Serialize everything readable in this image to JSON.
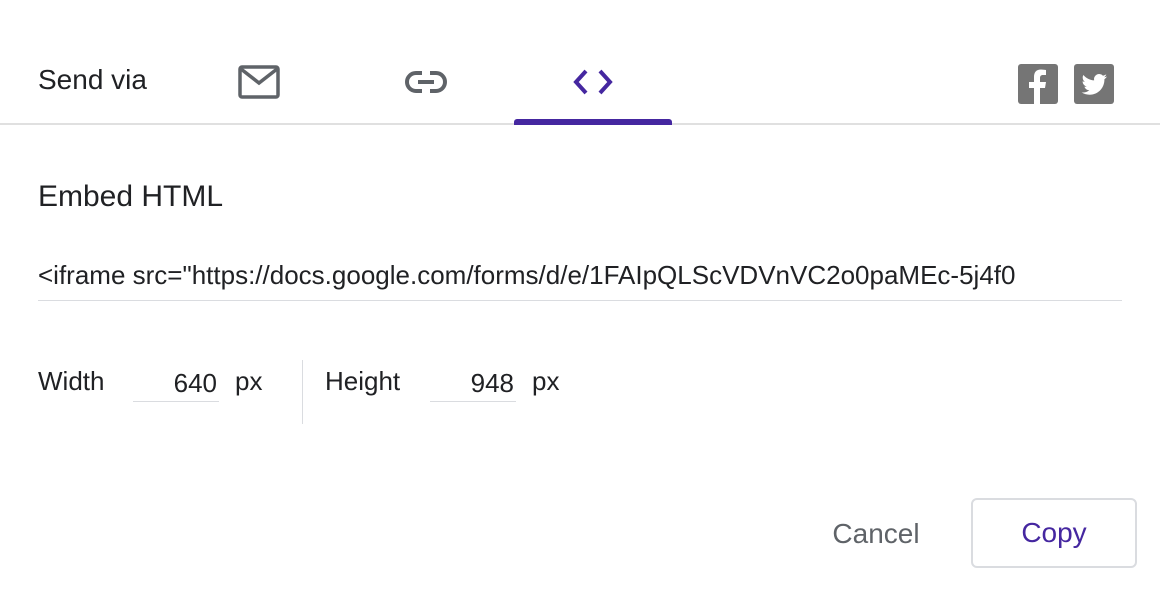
{
  "header": {
    "send_via_label": "Send via",
    "tabs": [
      {
        "icon": "mail-icon",
        "active": false
      },
      {
        "icon": "link-icon",
        "active": false
      },
      {
        "icon": "code-icon",
        "active": true
      }
    ],
    "social": [
      {
        "icon": "facebook-icon"
      },
      {
        "icon": "twitter-icon"
      }
    ],
    "accent_color": "#4527a0",
    "icon_color": "#5f6368"
  },
  "embed": {
    "title": "Embed HTML",
    "code": "<iframe src=\"https://docs.google.com/forms/d/e/1FAIpQLScVDVnVC2o0paMEc-5j4f0"
  },
  "dimensions": {
    "width_label": "Width",
    "width_value": "640",
    "width_unit": "px",
    "height_label": "Height",
    "height_value": "948",
    "height_unit": "px"
  },
  "actions": {
    "cancel_label": "Cancel",
    "copy_label": "Copy"
  }
}
